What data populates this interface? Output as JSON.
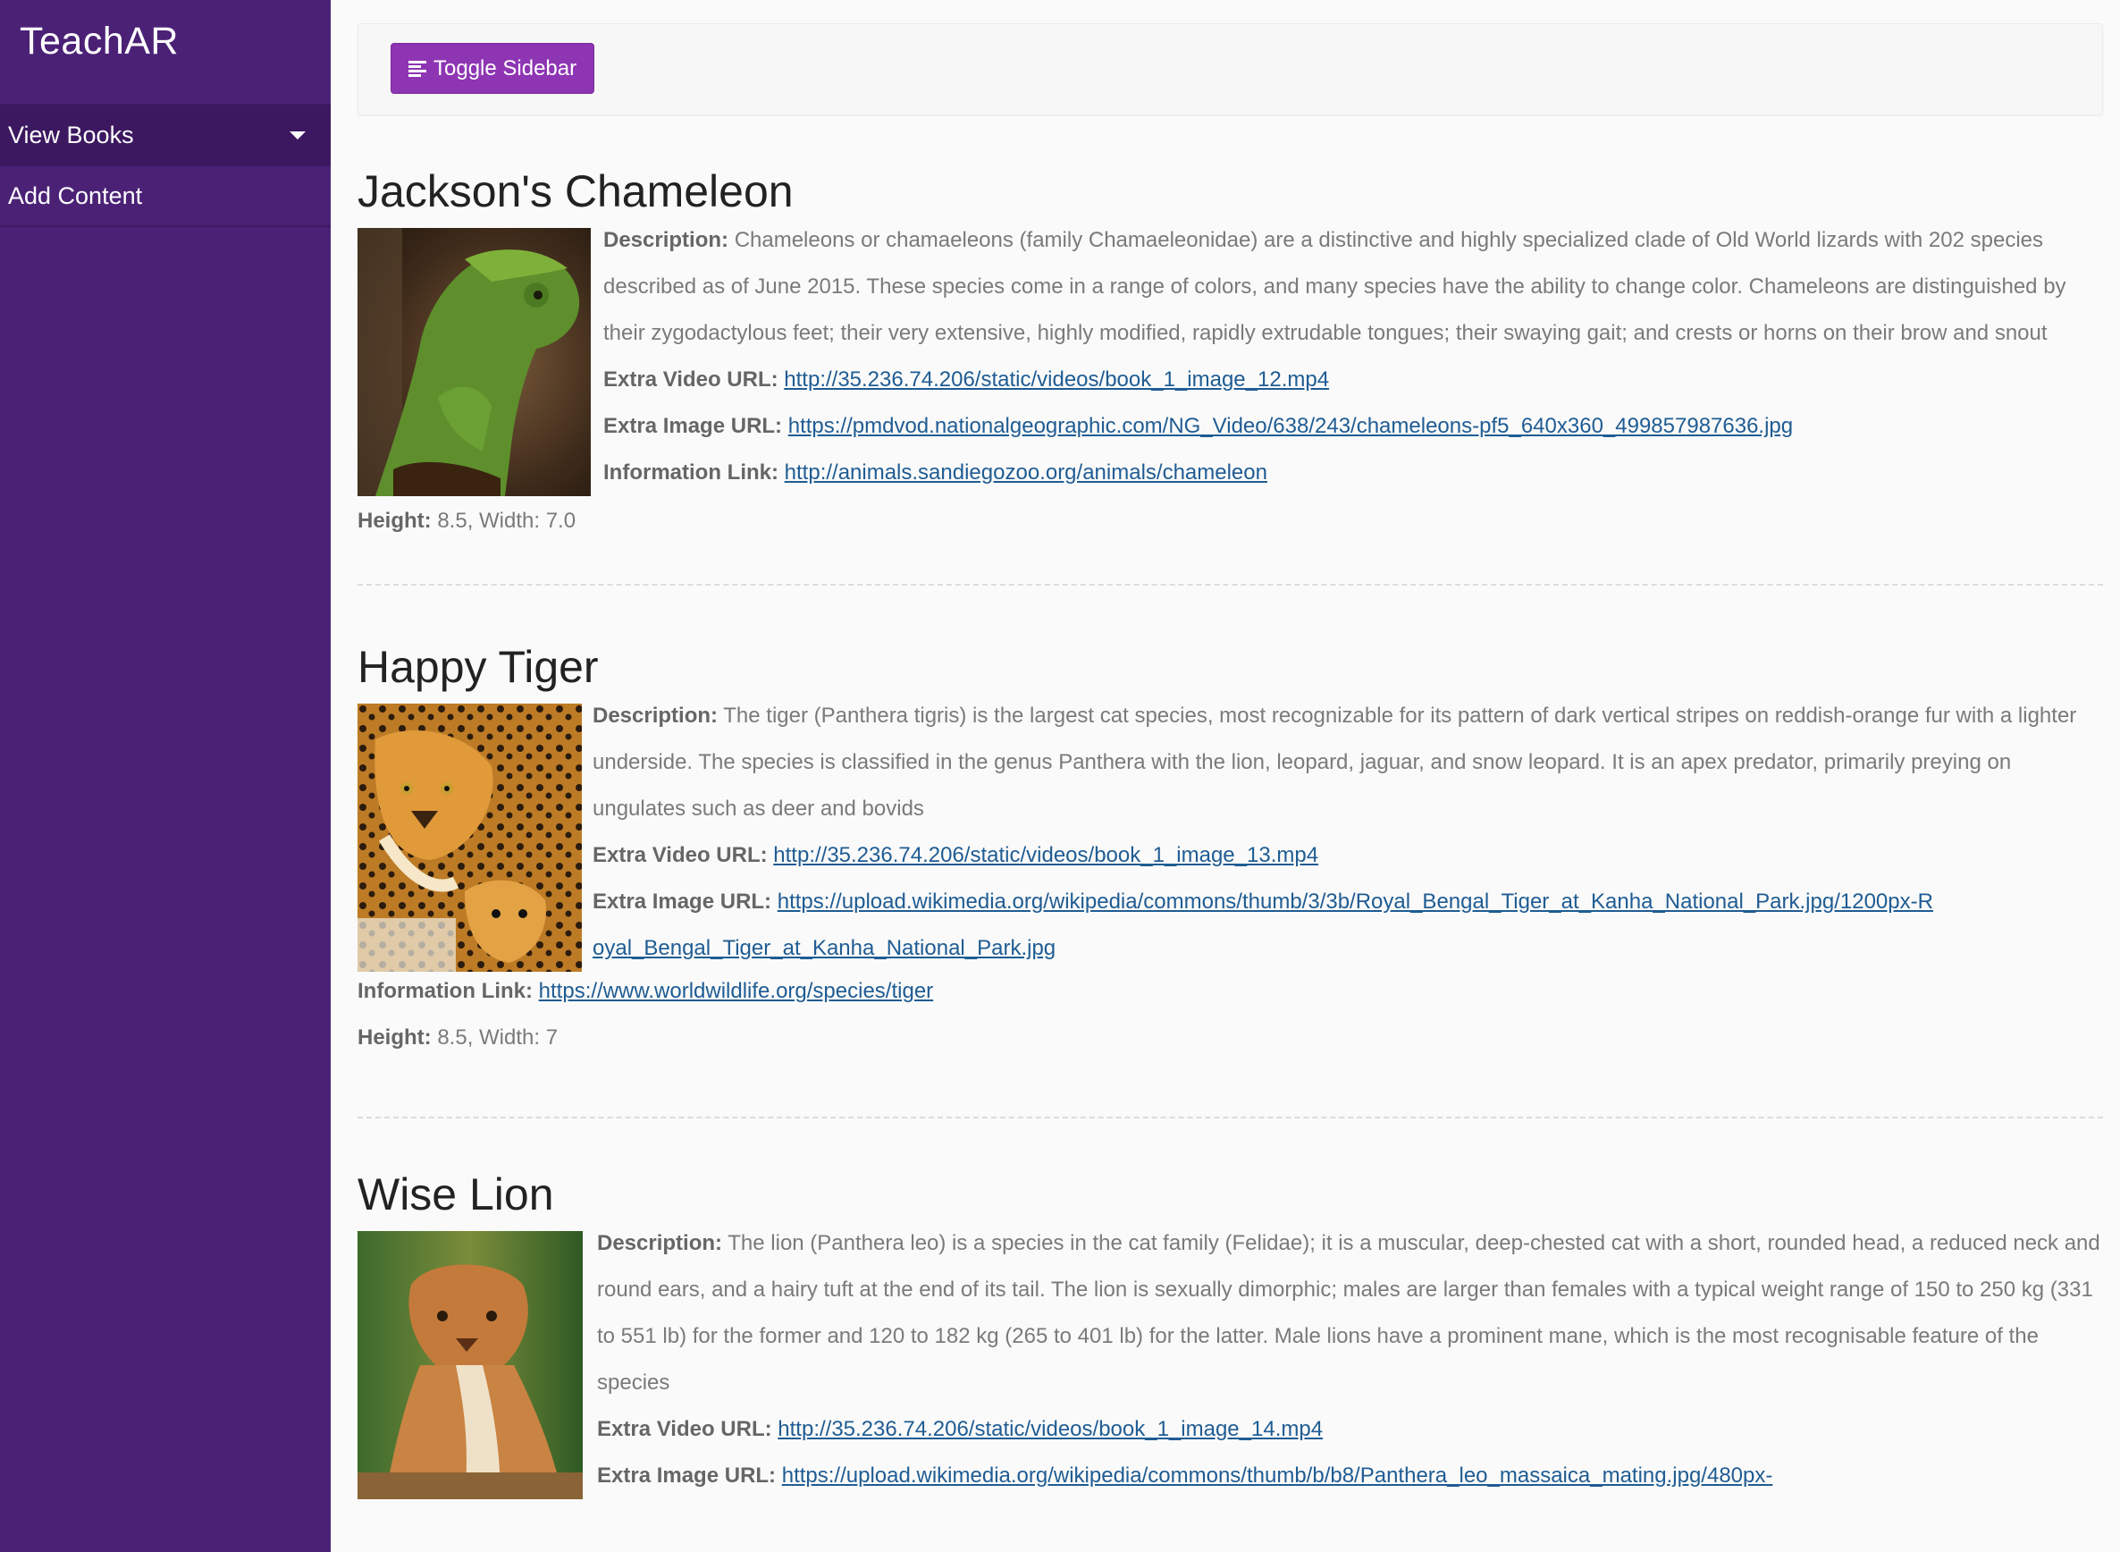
{
  "sidebar": {
    "brand": "TeachAR",
    "items": [
      {
        "label": "View Books"
      },
      {
        "label": "Add Content"
      }
    ]
  },
  "topbar": {
    "toggle_label": "Toggle Sidebar"
  },
  "labels": {
    "description": "Description:",
    "video": "Extra Video URL:",
    "image": "Extra Image URL:",
    "info": "Information Link:",
    "height": "Height:"
  },
  "books": [
    {
      "title": "Jackson's Chameleon",
      "description": "Chameleons or chamaeleons (family Chamaeleonidae) are a distinctive and highly specialized clade of Old World lizards with 202 species described as of June 2015. These species come in a range of colors, and many species have the ability to change color. Chameleons are distinguished by their zygodactylous feet; their very extensive, highly modified, rapidly extrudable tongues; their swaying gait; and crests or horns on their brow and snout",
      "video_url": "http://35.236.74.206/static/videos/book_1_image_12.mp4",
      "image_url": "https://pmdvod.nationalgeographic.com/NG_Video/638/243/chameleons-pf5_640x360_499857987636.jpg",
      "info_url": "http://animals.sandiegozoo.org/animals/chameleon",
      "dimensions": "8.5, Width: 7.0"
    },
    {
      "title": "Happy Tiger",
      "description": "The tiger (Panthera tigris) is the largest cat species, most recognizable for its pattern of dark vertical stripes on reddish-orange fur with a lighter underside. The species is classified in the genus Panthera with the lion, leopard, jaguar, and snow leopard. It is an apex predator, primarily preying on ungulates such as deer and bovids",
      "video_url": "http://35.236.74.206/static/videos/book_1_image_13.mp4",
      "image_url": "https://upload.wikimedia.org/wikipedia/commons/thumb/3/3b/Royal_Bengal_Tiger_at_Kanha_National_Park.jpg/1200px-Royal_Bengal_Tiger_at_Kanha_National_Park.jpg",
      "info_url": "https://www.worldwildlife.org/species/tiger",
      "dimensions": "8.5, Width: 7"
    },
    {
      "title": "Wise Lion",
      "description": "The lion (Panthera leo) is a species in the cat family (Felidae); it is a muscular, deep-chested cat with a short, rounded head, a reduced neck and round ears, and a hairy tuft at the end of its tail. The lion is sexually dimorphic; males are larger than females with a typical weight range of 150 to 250 kg (331 to 551 lb) for the former and 120 to 182 kg (265 to 401 lb) for the latter. Male lions have a prominent mane, which is the most recognisable feature of the species",
      "video_url": "http://35.236.74.206/static/videos/book_1_image_14.mp4",
      "image_url": "https://upload.wikimedia.org/wikipedia/commons/thumb/b/b8/Panthera_leo_massaica_mating.jpg/480px-"
    }
  ]
}
